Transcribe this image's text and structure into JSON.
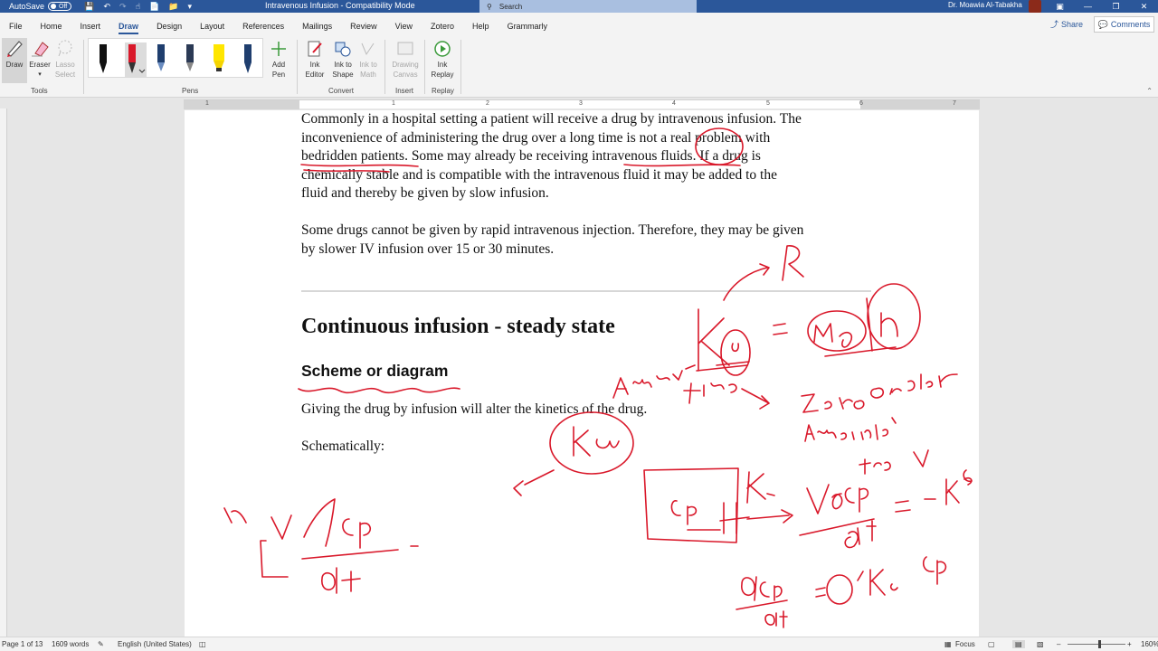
{
  "titlebar": {
    "autosave_label": "AutoSave",
    "autosave_state": "Off",
    "doc_title": "Intravenous Infusion  -  Compatibility Mode",
    "search_placeholder": "Search",
    "user_name": "Dr. Moawia Al-Tabakha"
  },
  "menu": {
    "tabs": [
      "File",
      "Home",
      "Insert",
      "Draw",
      "Design",
      "Layout",
      "References",
      "Mailings",
      "Review",
      "View",
      "Zotero",
      "Help",
      "Grammarly"
    ],
    "active_tab": "Draw",
    "share": "Share",
    "comments": "Comments"
  },
  "ribbon": {
    "tools": {
      "draw": "Draw",
      "eraser": "Eraser",
      "lasso_1": "Lasso",
      "lasso_2": "Select",
      "label": "Tools"
    },
    "pens": {
      "add_pen_1": "Add",
      "add_pen_2": "Pen",
      "label": "Pens"
    },
    "convert": {
      "ink_editor_1": "Ink",
      "ink_editor_2": "Editor",
      "ink_shape_1": "Ink to",
      "ink_shape_2": "Shape",
      "ink_math_1": "Ink to",
      "ink_math_2": "Math",
      "label": "Convert"
    },
    "insert": {
      "drawing_canvas_1": "Drawing",
      "drawing_canvas_2": "Canvas",
      "label": "Insert"
    },
    "replay": {
      "ink_replay_1": "Ink",
      "ink_replay_2": "Replay",
      "label": "Replay"
    }
  },
  "ruler": {
    "numbers": [
      "1",
      "1",
      "2",
      "3",
      "4",
      "5",
      "6",
      "7"
    ]
  },
  "document": {
    "para1_lines": [
      "Commonly in a hospital setting a patient will receive a drug by intravenous infusion. The",
      "inconvenience of administering the drug over a long time is not a real problem with",
      "bedridden patients. Some may already be receiving intravenous fluids. If a drug is",
      "chemically stable and is compatible with the intravenous fluid it may be added to the",
      "fluid and thereby be given by slow infusion."
    ],
    "para2_lines": [
      "Some drugs cannot be given by rapid intravenous injection. Therefore, they may be given",
      "by slower IV infusion over 15 or 30 minutes."
    ],
    "heading1": "Continuous infusion - steady state",
    "heading2": "Scheme or diagram",
    "para3": "Giving the drug by infusion will alter the kinetics of the drug.",
    "para4": "Schematically:"
  },
  "statusbar": {
    "page": "Page 1 of 13",
    "words": "1609 words",
    "language": "English (United States)",
    "focus": "Focus",
    "zoom": "160%"
  },
  "colors": {
    "accent": "#2b579a",
    "ink_red": "#d9182a",
    "ribbon_bg": "#f3f3f3"
  },
  "icons": [
    "save-icon",
    "undo-icon",
    "redo-icon",
    "touch-mode-icon",
    "open-icon",
    "customize-qat-icon",
    "search-icon",
    "ribbon-display-icon",
    "minimize-icon",
    "restore-icon",
    "close-icon",
    "share-icon",
    "comments-icon"
  ]
}
